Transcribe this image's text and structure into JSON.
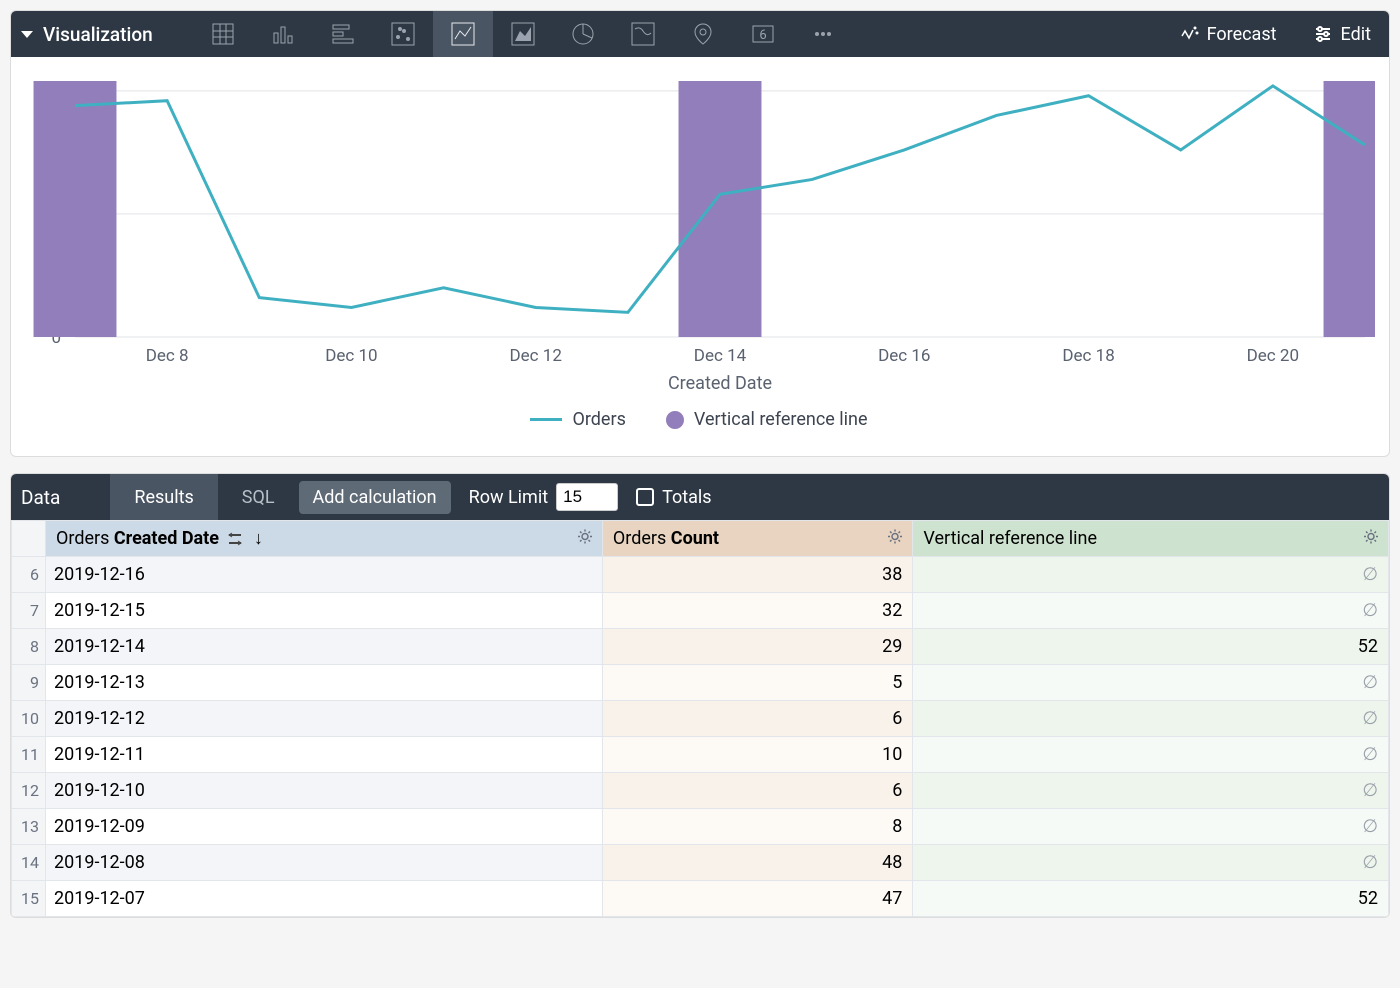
{
  "viz_bar": {
    "title": "Visualization",
    "forecast": "Forecast",
    "edit": "Edit"
  },
  "chart_data": {
    "type": "line",
    "title": "",
    "xlabel": "Created Date",
    "ylabel": "",
    "ylim": [
      0,
      50
    ],
    "yticks": [
      0,
      25,
      50
    ],
    "categories": [
      "Dec 7",
      "Dec 8",
      "Dec 9",
      "Dec 10",
      "Dec 11",
      "Dec 12",
      "Dec 13",
      "Dec 14",
      "Dec 15",
      "Dec 16",
      "Dec 17",
      "Dec 18",
      "Dec 19",
      "Dec 20",
      "Dec 21"
    ],
    "xticks": [
      "Dec 8",
      "Dec 10",
      "Dec 12",
      "Dec 14",
      "Dec 16",
      "Dec 18",
      "Dec 20"
    ],
    "series": [
      {
        "name": "Orders",
        "type": "line",
        "color": "#3fb0c1",
        "values": [
          47,
          48,
          8,
          6,
          10,
          6,
          5,
          29,
          32,
          38,
          45,
          49,
          38,
          51,
          39
        ]
      },
      {
        "name": "Vertical reference line",
        "type": "bar",
        "color": "#917eba",
        "values": [
          52,
          null,
          null,
          null,
          null,
          null,
          null,
          52,
          null,
          null,
          null,
          null,
          null,
          null,
          52
        ]
      }
    ]
  },
  "legend": {
    "orders": "Orders",
    "ref": "Vertical reference line"
  },
  "data_bar": {
    "title": "Data",
    "tabs": {
      "results": "Results",
      "sql": "SQL"
    },
    "add_calc": "Add calculation",
    "row_limit_label": "Row Limit",
    "row_limit_value": "15",
    "totals": "Totals"
  },
  "table": {
    "headers": {
      "date_prefix": "Orders ",
      "date_bold": "Created Date",
      "count_prefix": "Orders ",
      "count_bold": "Count",
      "ref": "Vertical reference line"
    },
    "rows": [
      {
        "n": "6",
        "date": "2019-12-16",
        "count": "38",
        "ref": "∅"
      },
      {
        "n": "7",
        "date": "2019-12-15",
        "count": "32",
        "ref": "∅"
      },
      {
        "n": "8",
        "date": "2019-12-14",
        "count": "29",
        "ref": "52"
      },
      {
        "n": "9",
        "date": "2019-12-13",
        "count": "5",
        "ref": "∅"
      },
      {
        "n": "10",
        "date": "2019-12-12",
        "count": "6",
        "ref": "∅"
      },
      {
        "n": "11",
        "date": "2019-12-11",
        "count": "10",
        "ref": "∅"
      },
      {
        "n": "12",
        "date": "2019-12-10",
        "count": "6",
        "ref": "∅"
      },
      {
        "n": "13",
        "date": "2019-12-09",
        "count": "8",
        "ref": "∅"
      },
      {
        "n": "14",
        "date": "2019-12-08",
        "count": "48",
        "ref": "∅"
      },
      {
        "n": "15",
        "date": "2019-12-07",
        "count": "47",
        "ref": "52"
      }
    ]
  }
}
